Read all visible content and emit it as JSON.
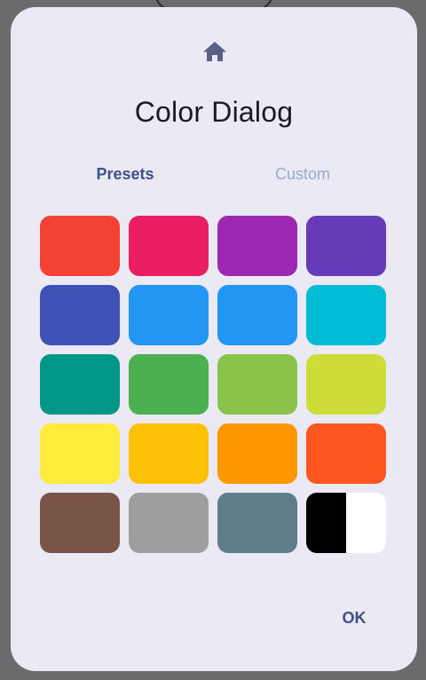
{
  "dialog": {
    "icon": "home-icon",
    "title": "Color Dialog",
    "ok_label": "OK"
  },
  "tabs": [
    {
      "label": "Presets",
      "selected": true
    },
    {
      "label": "Custom",
      "selected": false
    }
  ],
  "colors": {
    "accent": "#3f5088",
    "dialog_background": "#eae9f4"
  },
  "swatches": [
    {
      "name": "swatch-red",
      "color": "#f44336"
    },
    {
      "name": "swatch-pink",
      "color": "#e91e63"
    },
    {
      "name": "swatch-purple",
      "color": "#9c27b0"
    },
    {
      "name": "swatch-deep-purple",
      "color": "#673ab7"
    },
    {
      "name": "swatch-indigo",
      "color": "#3f51b5"
    },
    {
      "name": "swatch-blue",
      "color": "#2196f3"
    },
    {
      "name": "swatch-light-blue",
      "color": "#2196f3"
    },
    {
      "name": "swatch-cyan",
      "color": "#00bcd4"
    },
    {
      "name": "swatch-teal",
      "color": "#009688"
    },
    {
      "name": "swatch-green",
      "color": "#4caf50"
    },
    {
      "name": "swatch-light-green",
      "color": "#8bc34a"
    },
    {
      "name": "swatch-lime",
      "color": "#cddc39"
    },
    {
      "name": "swatch-yellow",
      "color": "#ffeb3b"
    },
    {
      "name": "swatch-amber",
      "color": "#ffc107"
    },
    {
      "name": "swatch-orange",
      "color": "#ff9800"
    },
    {
      "name": "swatch-deep-orange",
      "color": "#ff5722"
    },
    {
      "name": "swatch-brown",
      "color": "#795548"
    },
    {
      "name": "swatch-grey",
      "color": "#9e9e9e"
    },
    {
      "name": "swatch-blue-grey",
      "color": "#607d8b"
    },
    {
      "name": "swatch-black-white",
      "color": "#000000",
      "color2": "#ffffff"
    }
  ]
}
